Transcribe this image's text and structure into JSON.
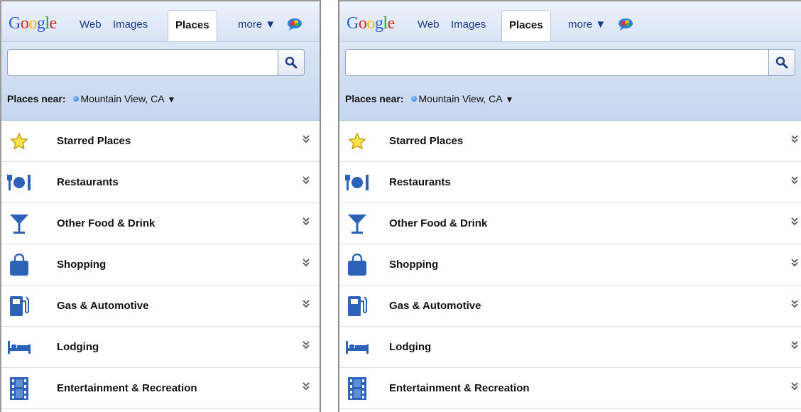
{
  "colors": {
    "link": "#1a3a8f",
    "accent": "#2a5db0",
    "icon_blue": "#2c63b8"
  },
  "panels": [
    {
      "logo": [
        "G",
        "o",
        "o",
        "g",
        "l",
        "e"
      ],
      "tabs": {
        "web": "Web",
        "images": "Images",
        "places": "Places",
        "more": "more ▼"
      },
      "search": {
        "value": "",
        "placeholder": ""
      },
      "near": {
        "label": "Places near:",
        "location": "Mountain View, CA",
        "arrow": "▼"
      },
      "rows": [
        {
          "label": "Starred Places",
          "icon": "star-icon"
        },
        {
          "label": "Restaurants",
          "icon": "restaurant-icon"
        },
        {
          "label": "Other Food & Drink",
          "icon": "cocktail-icon"
        },
        {
          "label": "Shopping",
          "icon": "shopping-bag-icon"
        },
        {
          "label": "Gas & Automotive",
          "icon": "gas-pump-icon"
        },
        {
          "label": "Lodging",
          "icon": "bed-icon"
        },
        {
          "label": "Entertainment & Recreation",
          "icon": "film-icon"
        }
      ]
    },
    {
      "logo": [
        "G",
        "o",
        "o",
        "g",
        "l",
        "e"
      ],
      "tabs": {
        "web": "Web",
        "images": "Images",
        "places": "Places",
        "more": "more ▼"
      },
      "search": {
        "value": "",
        "placeholder": ""
      },
      "near": {
        "label": "Places near:",
        "location": "Mountain View, CA",
        "arrow": "▼"
      },
      "rows": [
        {
          "label": "Starred Places",
          "icon": "star-icon"
        },
        {
          "label": "Restaurants",
          "icon": "restaurant-icon"
        },
        {
          "label": "Other Food & Drink",
          "icon": "cocktail-icon"
        },
        {
          "label": "Shopping",
          "icon": "shopping-bag-icon"
        },
        {
          "label": "Gas & Automotive",
          "icon": "gas-pump-icon"
        },
        {
          "label": "Lodging",
          "icon": "bed-icon"
        },
        {
          "label": "Entertainment & Recreation",
          "icon": "film-icon"
        }
      ]
    }
  ]
}
